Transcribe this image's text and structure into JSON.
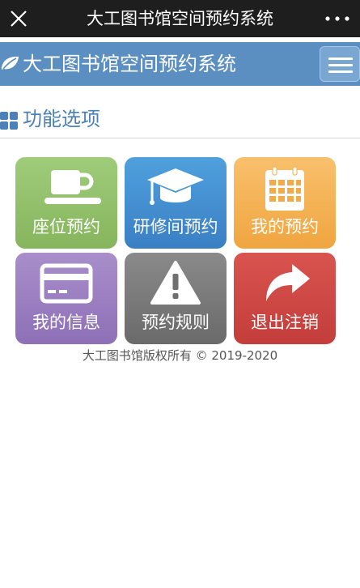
{
  "window": {
    "title": "大工图书馆空间预约系统",
    "close_icon": "close-icon",
    "more_icon": "more-dots-icon"
  },
  "header": {
    "brand": "大工图书馆空间预约系统",
    "logo_icon": "leaf-icon",
    "menu_icon": "hamburger-menu-icon"
  },
  "section": {
    "title": "功能选项",
    "icon": "grid-icon"
  },
  "tiles": [
    {
      "label": "座位预约",
      "icon": "coffee-cup-icon",
      "color": "#92c06b"
    },
    {
      "label": "研修间预约",
      "icon": "graduation-cap-icon",
      "color": "#4590d1"
    },
    {
      "label": "我的预约",
      "icon": "calendar-icon",
      "color": "#f4b256"
    },
    {
      "label": "我的信息",
      "icon": "credit-card-icon",
      "color": "#9b7fc1"
    },
    {
      "label": "预约规则",
      "icon": "warning-icon",
      "color": "#7a7a7a"
    },
    {
      "label": "退出注销",
      "icon": "share-arrow-icon",
      "color": "#ce4844"
    }
  ],
  "footer": {
    "copyright": "大工图书馆版权所有 © 2019-2020"
  },
  "colors": {
    "topbar": "#1e1e1e",
    "header": "#5b8fc2",
    "section_title": "#4b80b8"
  }
}
